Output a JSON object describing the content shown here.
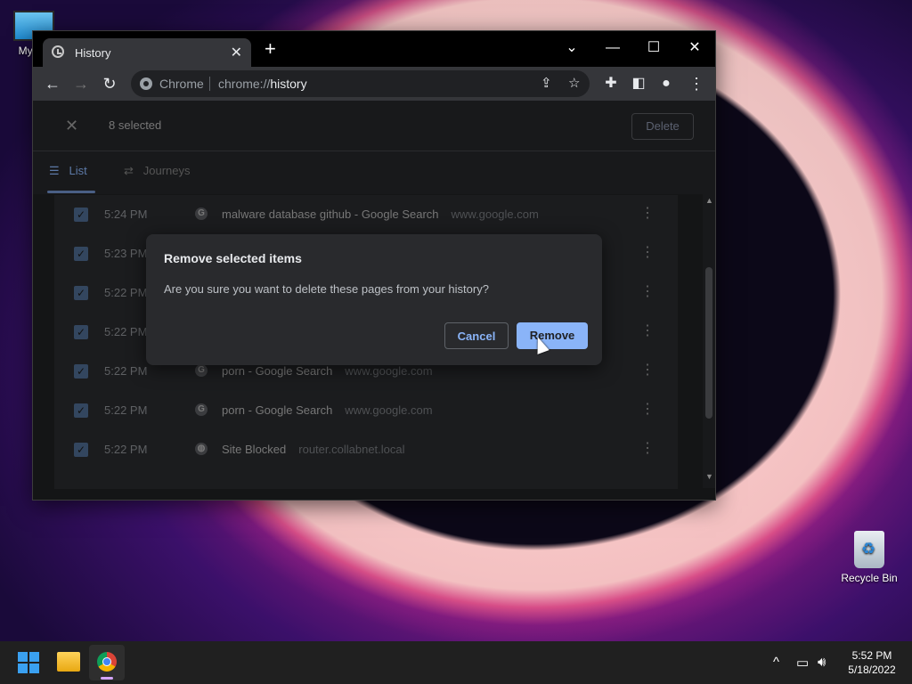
{
  "desktop": {
    "icons": [
      {
        "label": "My Co"
      },
      {
        "label": "Recycle Bin"
      }
    ]
  },
  "browser": {
    "tab_title": "History",
    "tab_close": "✕",
    "new_tab": "+",
    "window_controls": {
      "dropdown": "⌄",
      "minimize": "—",
      "maximize": "☐",
      "close": "✕"
    },
    "omnibox": {
      "chip": "Chrome",
      "url_prefix": "chrome://",
      "url_path": "history"
    }
  },
  "history": {
    "selection": {
      "count_label": "8 selected",
      "delete_label": "Delete",
      "close": "✕"
    },
    "tabs": [
      {
        "label": "List"
      },
      {
        "label": "Journeys"
      }
    ],
    "rows": [
      {
        "time": "5:24 PM",
        "favicon": "G",
        "title": "malware database github - Google Search",
        "domain": "www.google.com"
      },
      {
        "time": "5:23 PM",
        "favicon": "G",
        "title": "",
        "domain": ""
      },
      {
        "time": "5:22 PM",
        "favicon": "G",
        "title": "",
        "domain": ""
      },
      {
        "time": "5:22 PM",
        "favicon": "G",
        "title": "",
        "domain": ""
      },
      {
        "time": "5:22 PM",
        "favicon": "G",
        "title": "porn - Google Search",
        "domain": "www.google.com"
      },
      {
        "time": "5:22 PM",
        "favicon": "G",
        "title": "porn - Google Search",
        "domain": "www.google.com"
      },
      {
        "time": "5:22 PM",
        "favicon": "globe",
        "title": "Site Blocked",
        "domain": "router.collabnet.local"
      }
    ]
  },
  "dialog": {
    "title": "Remove selected items",
    "message": "Are you sure you want to delete these pages from your history?",
    "cancel_label": "Cancel",
    "remove_label": "Remove"
  },
  "taskbar": {
    "time": "5:52 PM",
    "date": "5/18/2022",
    "tray_chevron": "^"
  },
  "colors": {
    "accent": "#8ab4f8",
    "page_bg": "#202124",
    "toolbar_bg": "#35363a"
  }
}
